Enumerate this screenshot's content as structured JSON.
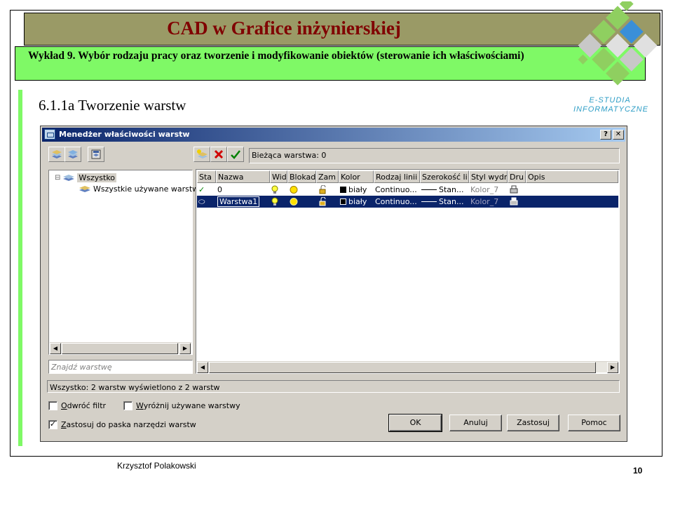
{
  "slide": {
    "title": "CAD w Grafice inżynierskiej",
    "subtitle": "Wykład 9.  Wybór rodzaju pracy oraz tworzenie i modyfikowanie obiektów (sterowanie ich właściwościami)",
    "section_heading": "6.1.1a Tworzenie warstw",
    "logo_text_line1": "E-STUDIA",
    "logo_text_line2": "INFORMATYCZNE",
    "author": "Krzysztof Polakowski",
    "page_number": "10"
  },
  "dialog": {
    "title": "Menedżer właściwości warstw",
    "help_btn": "?",
    "close_btn": "✕",
    "current_layer_label": "Bieżąca warstwa: 0",
    "tree": {
      "root": "Wszystko",
      "expander": "⊟",
      "child": "Wszystkie używane warstwy"
    },
    "search_placeholder": "Znajdź warstwę",
    "columns": [
      "Sta",
      "Nazwa",
      "Wid",
      "Blokad",
      "Zam",
      "Kolor",
      "Rodzaj linii",
      "Szerokość li",
      "Styl wydr",
      "Dru",
      "Opis"
    ],
    "rows": [
      {
        "status": "✓",
        "name": "0",
        "color": "biały",
        "linetype": "Continuo...",
        "lineweight": "Stan...",
        "plotstyle": "Kolor_7",
        "selected": false
      },
      {
        "status": "⬭",
        "name": "Warstwa1",
        "color": "biały",
        "linetype": "Continuo...",
        "lineweight": "Stan...",
        "plotstyle": "Kolor_7",
        "selected": true
      }
    ],
    "status_text": "Wszystko: 2 warstw wyświetlono z 2 warstw",
    "invert_filter_label": "Odwróć filtr",
    "invert_filter_checked": false,
    "highlight_used_label": "Wyróżnij używane warstwy",
    "highlight_used_checked": false,
    "apply_toolbar_label": "Zastosuj do paska narzędzi warstw",
    "apply_toolbar_checked": true,
    "check_mark": "✓",
    "buttons": {
      "ok": "OK",
      "cancel": "Anuluj",
      "apply": "Zastosuj",
      "help": "Pomoc"
    }
  },
  "colors": {
    "title_bg": "#9a9a66",
    "title_text": "#800000",
    "subtitle_bg": "#7ff966",
    "selection_bg": "#0a246a",
    "logo_text": "#2f9ec6"
  }
}
